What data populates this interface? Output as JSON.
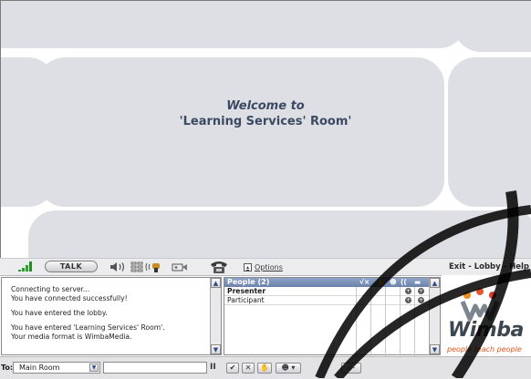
{
  "stage": {
    "welcome_line1": "Welcome to",
    "welcome_line2": "'Learning Services' Room'"
  },
  "toolbar": {
    "talk_label": "TALK",
    "options_label": "Options",
    "exit_links": "Exit - Lobby - Help",
    "icons": [
      "signal-strength-icon",
      "speaker-icon",
      "audio-level-icon",
      "hand-mic-icon",
      "video-camera-icon",
      "telephone-icon"
    ]
  },
  "chat": {
    "messages": [
      "Connecting to server...",
      "You have connected successfully!",
      "",
      "You have entered the lobby.",
      "",
      "You have entered 'Learning Services' Room'.",
      "Your media format is WimbaMedia."
    ]
  },
  "people": {
    "title": "People (2)",
    "header_icons": [
      "√×",
      "hand",
      "smile",
      "mic",
      "video"
    ],
    "rows": [
      {
        "label": "Presenter",
        "bold": true
      },
      {
        "label": "Participant",
        "bold": false
      }
    ]
  },
  "bottom": {
    "to_label": "To:",
    "room_value": "Main Room",
    "chat_input_value": "",
    "pause_label": "II",
    "buttons": [
      "✔",
      "✕",
      "✋",
      "☻ ▾",
      "-/-"
    ]
  },
  "logo": {
    "word": "Wimba",
    "tagline": "people teach people"
  },
  "colors": {
    "tile": "#dedfe5",
    "welcome_text": "#3b4a62",
    "people_header": "#7a8fb6",
    "signal_green": "#2aa12a",
    "tagline_orange": "#e2561c"
  }
}
